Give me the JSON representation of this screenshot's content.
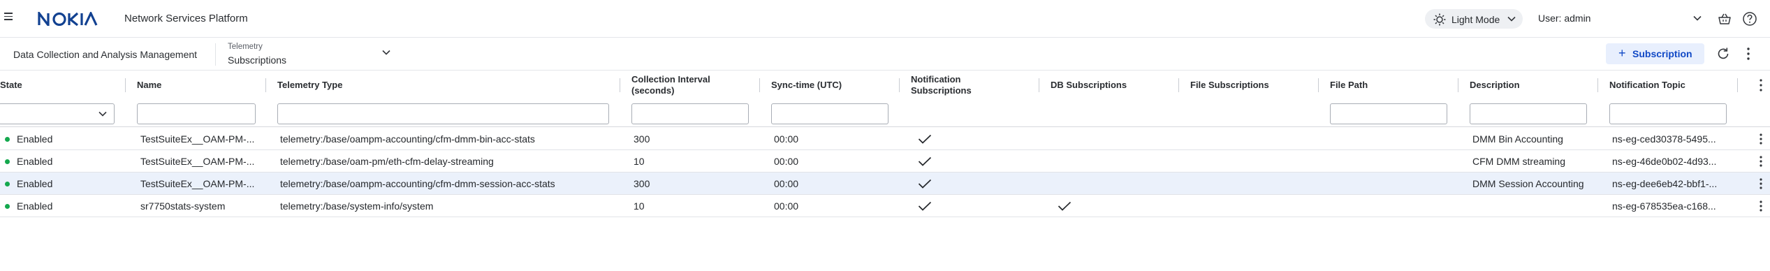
{
  "header": {
    "app_title": "Network Services Platform",
    "theme_label": "Light Mode",
    "user_label": "User: admin",
    "icons": [
      "menu-icon",
      "sun-icon",
      "chevron-down-icon",
      "basket-icon",
      "help-icon"
    ]
  },
  "subheader": {
    "breadcrumb": "Data Collection and Analysis Management",
    "selector_small": "Telemetry",
    "selector_value": "Subscriptions",
    "subscription_button": "Subscription",
    "plus": "+"
  },
  "table": {
    "columns": {
      "state": "State",
      "name": "Name",
      "telemetry_type": "Telemetry Type",
      "interval_1": "Collection Interval",
      "interval_2": "(seconds)",
      "sync": "Sync-time (UTC)",
      "notif_1": "Notification",
      "notif_2": "Subscriptions",
      "db": "DB Subscriptions",
      "file": "File Subscriptions",
      "path": "File Path",
      "desc": "Description",
      "topic": "Notification Topic"
    },
    "rows": [
      {
        "state": "Enabled",
        "name": "TestSuiteEx__OAM-PM-...",
        "type": "telemetry:/base/oampm-accounting/cfm-dmm-bin-acc-stats",
        "interval": "300",
        "sync": "00:00",
        "notif": true,
        "db": false,
        "desc": "DMM Bin Accounting",
        "topic": "ns-eg-ced30378-5495...",
        "selected": false
      },
      {
        "state": "Enabled",
        "name": "TestSuiteEx__OAM-PM-...",
        "type": "telemetry:/base/oam-pm/eth-cfm-delay-streaming",
        "interval": "10",
        "sync": "00:00",
        "notif": true,
        "db": false,
        "desc": "CFM DMM streaming",
        "topic": "ns-eg-46de0b02-4d93...",
        "selected": false
      },
      {
        "state": "Enabled",
        "name": "TestSuiteEx__OAM-PM-...",
        "type": "telemetry:/base/oampm-accounting/cfm-dmm-session-acc-stats",
        "interval": "300",
        "sync": "00:00",
        "notif": true,
        "db": false,
        "desc": "DMM Session Accounting",
        "topic": "ns-eg-dee6eb42-bbf1-...",
        "selected": true
      },
      {
        "state": "Enabled",
        "name": "sr7750stats-system",
        "type": "telemetry:/base/system-info/system",
        "interval": "10",
        "sync": "00:00",
        "notif": true,
        "db": true,
        "desc": "",
        "topic": "ns-eg-678535ea-c168...",
        "selected": false
      }
    ]
  },
  "colors": {
    "accent": "#1149c6",
    "accent_bg": "#e8effd",
    "status_enabled": "#14a84e",
    "selected_row": "#ebf1fb"
  }
}
